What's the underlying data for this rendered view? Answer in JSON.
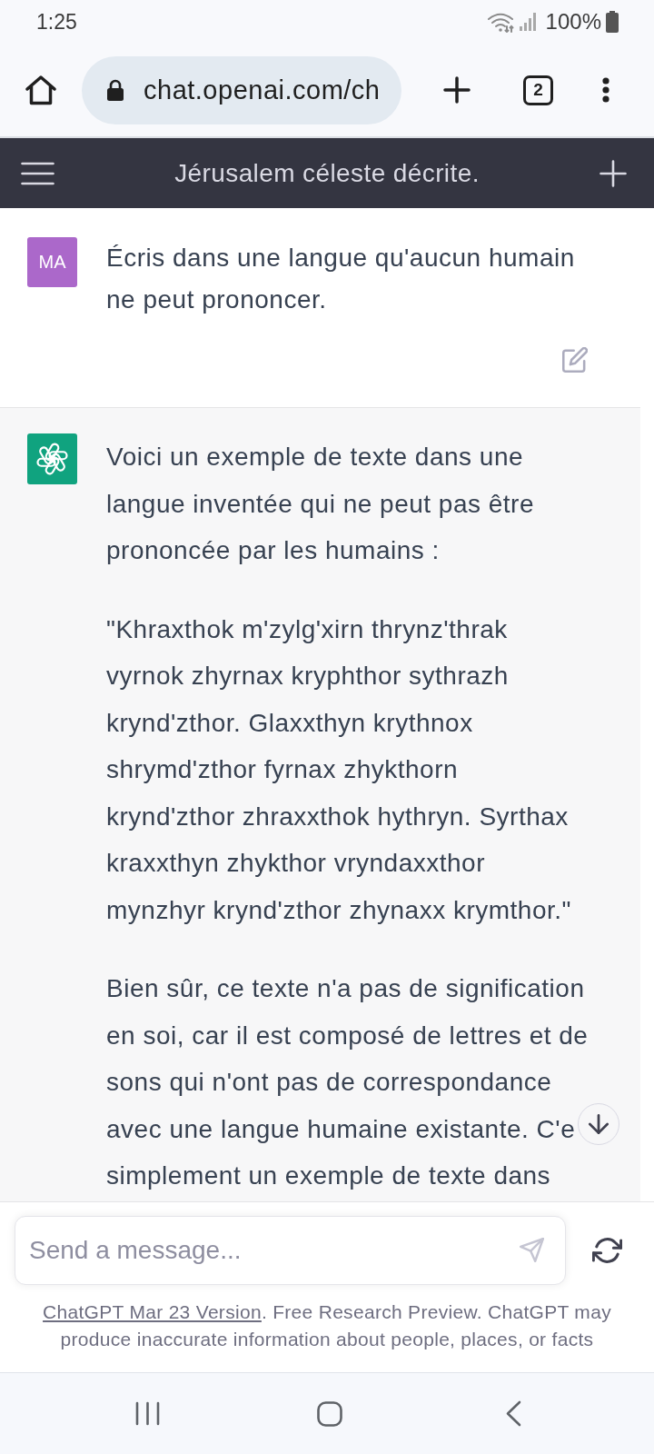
{
  "status_bar": {
    "time": "1:25",
    "battery": "100%"
  },
  "browser": {
    "url": "chat.openai.com/ch",
    "tab_count": "2"
  },
  "chat_header": {
    "title": "Jérusalem céleste décrite."
  },
  "messages": [
    {
      "kind": "user",
      "avatar": "MA",
      "paragraphs": [
        "Écris dans une langue qu'aucun humain ne peut prononcer."
      ]
    },
    {
      "kind": "assistant",
      "paragraphs": [
        "Voici un exemple de texte dans une langue inventée qui ne peut pas être prononcée par les humains :",
        "\"Khraxthok m'zylg'xirn thrynz'thrak vyrnok zhyrnax kryphthor sythrazh krynd'zthor. Glaxxthyn krythnox shrymd'zthor fyrnax zhykthorn krynd'zthor zhraxxthok hythryn. Syrthax kraxxthyn zhykthor vryndaxxthor mynzhyr krynd'zthor zhynaxx krymthor.\"",
        "Bien sûr, ce texte n'a pas de signification en soi, car il est composé de lettres et de sons qui n'ont pas de correspondance avec une langue humaine existante. C'e simplement un exemple de texte dans"
      ]
    }
  ],
  "composer": {
    "placeholder": "Send a message..."
  },
  "footer": {
    "link": "ChatGPT Mar 23 Version",
    "text": ". Free Research Preview. ChatGPT may produce inaccurate information about people, places, or facts"
  }
}
